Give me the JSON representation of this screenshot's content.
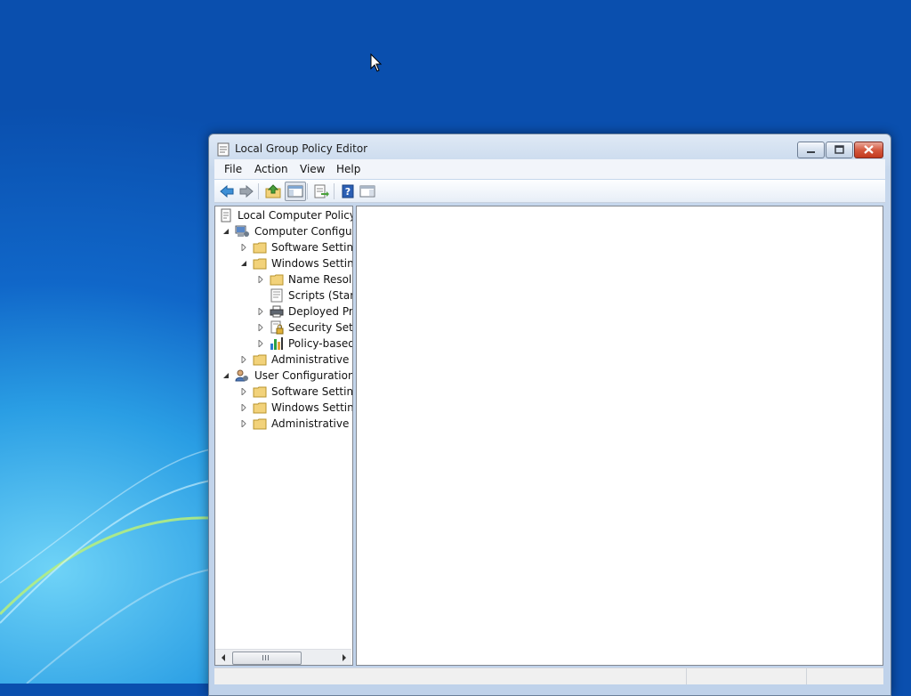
{
  "window": {
    "title": "Local Group Policy Editor",
    "caption_buttons": [
      "minimize",
      "maximize",
      "close"
    ]
  },
  "menu": [
    {
      "label": "File"
    },
    {
      "label": "Action"
    },
    {
      "label": "View"
    },
    {
      "label": "Help"
    }
  ],
  "toolbar": [
    {
      "icon": "back-arrow-icon"
    },
    {
      "icon": "forward-arrow-icon"
    },
    {
      "icon": "up-folder-icon"
    },
    {
      "icon": "show-hide-tree-icon"
    },
    {
      "icon": "export-list-icon"
    },
    {
      "icon": "help-icon"
    },
    {
      "icon": "show-hide-action-pane-icon"
    }
  ],
  "tree": [
    {
      "label": "Local Computer Policy",
      "icon": "policy-document-icon",
      "expander": "none"
    },
    {
      "label": "Computer Configura",
      "icon": "computer-config-icon",
      "expander": "expanded"
    },
    {
      "label": "Software Settings",
      "icon": "folder-icon",
      "expander": "collapsed"
    },
    {
      "label": "Windows Setting",
      "icon": "folder-icon",
      "expander": "expanded"
    },
    {
      "label": "Name Resolu",
      "icon": "folder-icon",
      "expander": "collapsed"
    },
    {
      "label": "Scripts (Startu",
      "icon": "script-icon",
      "expander": "none"
    },
    {
      "label": "Deployed Prir",
      "icon": "printer-icon",
      "expander": "collapsed"
    },
    {
      "label": "Security Settin",
      "icon": "security-icon",
      "expander": "collapsed"
    },
    {
      "label": "Policy-based",
      "icon": "qos-chart-icon",
      "expander": "collapsed"
    },
    {
      "label": "Administrative Te",
      "icon": "folder-icon",
      "expander": "collapsed"
    },
    {
      "label": "User Configuration",
      "icon": "user-config-icon",
      "expander": "expanded"
    },
    {
      "label": "Software Settings",
      "icon": "folder-icon",
      "expander": "collapsed"
    },
    {
      "label": "Windows Setting",
      "icon": "folder-icon",
      "expander": "collapsed"
    },
    {
      "label": "Administrative Te",
      "icon": "folder-icon",
      "expander": "collapsed"
    }
  ],
  "scrollbar": {
    "thumb_grip": "III"
  },
  "colors": {
    "folder": "#f2d27a",
    "selection_border": "#7da2ce",
    "window_frame": "#c6d7ec"
  }
}
